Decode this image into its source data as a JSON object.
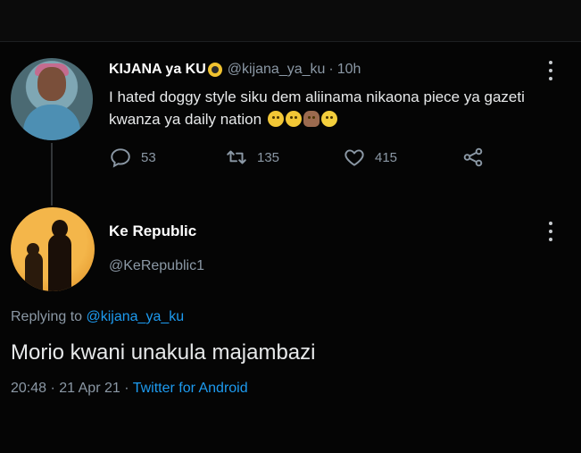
{
  "tweet1": {
    "name": "KIJANA ya KU",
    "name_emoji_icon": "radioactive-icon",
    "handle": "@kijana_ya_ku",
    "separator": "·",
    "time": "10h",
    "text": "I hated doggy style siku dem aliinama nikaona piece ya gazeti kwanza ya daily nation",
    "emojis": [
      "unamused-face",
      "expressionless-face",
      "person-facepalming",
      "laughing-face"
    ],
    "reply_count": "53",
    "retweet_count": "135",
    "like_count": "415"
  },
  "tweet2": {
    "name": "Ke Republic",
    "handle": "@KeRepublic1",
    "replying_prefix": "Replying to",
    "replying_to": "@kijana_ya_ku",
    "text": "Morio kwani unakula majambazi",
    "timestamp": "20:48 · 21 Apr 21 ·",
    "source": "Twitter for Android"
  },
  "colors": {
    "background": "#050505",
    "text": "#e7e9ea",
    "muted": "#8b98a5",
    "link": "#1d9bf0"
  }
}
